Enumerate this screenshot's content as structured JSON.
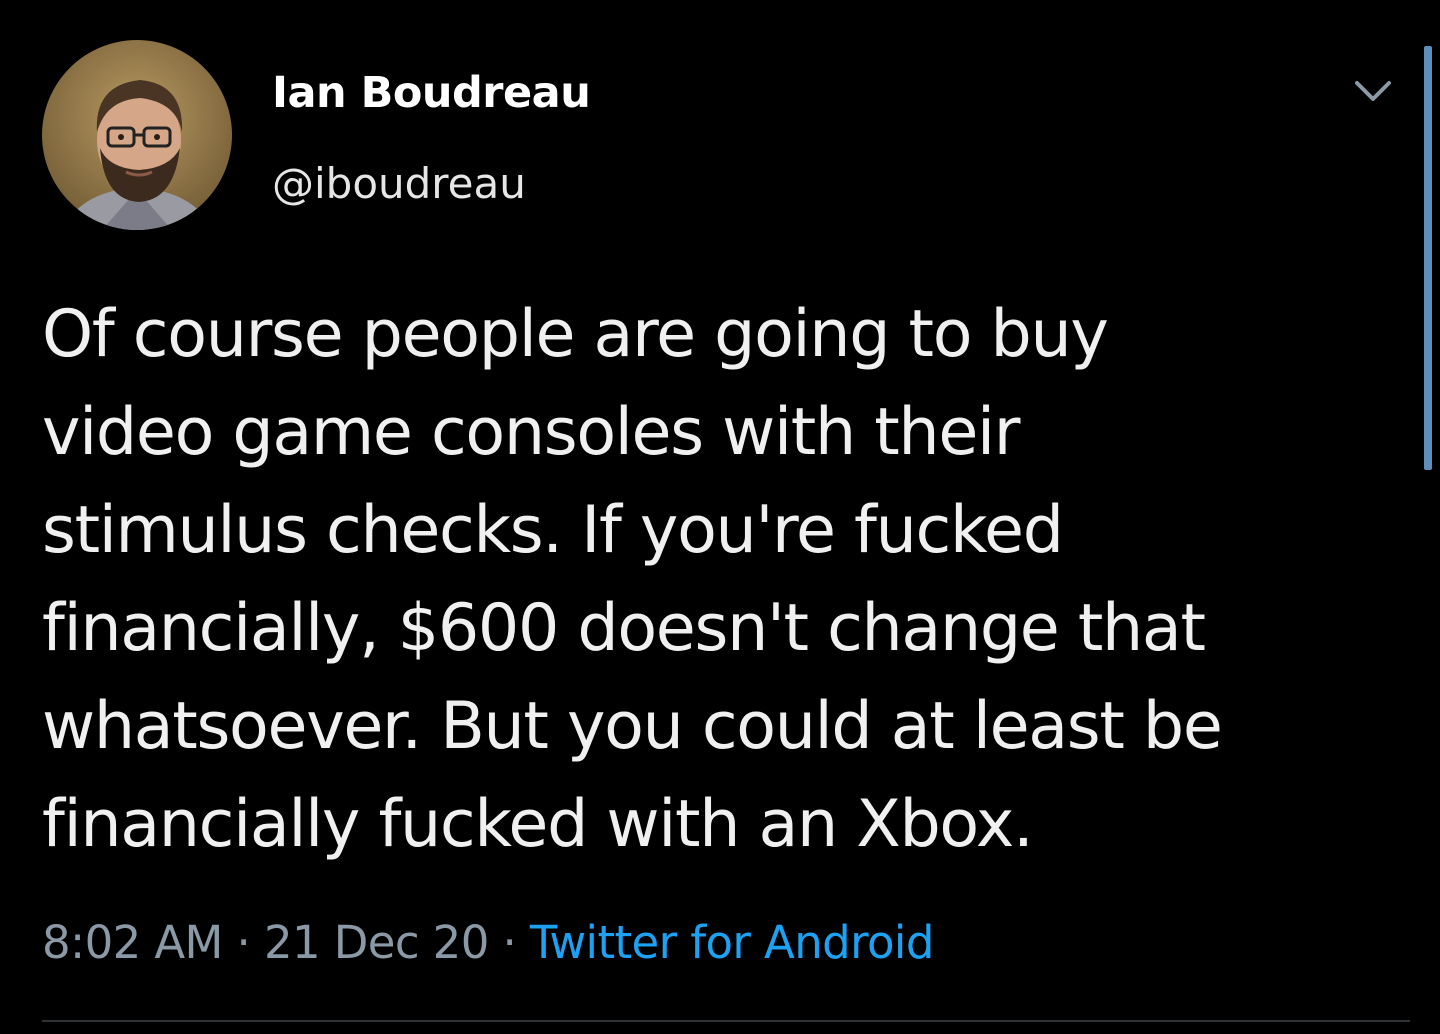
{
  "tweet": {
    "author": {
      "display_name": "Ian Boudreau",
      "handle": "@iboudreau",
      "avatar_icon": "profile-photo"
    },
    "text": "Of course people are going to buy\nvideo game consoles with their\nstimulus checks. If you're fucked\nfinancially, $600 doesn't change that\nwhatsoever. But you could at least be\nfinancially fucked with an Xbox.",
    "time": "8:02 AM",
    "separator": "·",
    "date": "21 Dec 20",
    "source": "Twitter for Android",
    "menu_icon": "chevron-down-icon"
  },
  "colors": {
    "background": "#000000",
    "text": "#f0f0f0",
    "muted": "#8b98a5",
    "link": "#1da1f2",
    "scrollbar": "#5d8fb8"
  }
}
